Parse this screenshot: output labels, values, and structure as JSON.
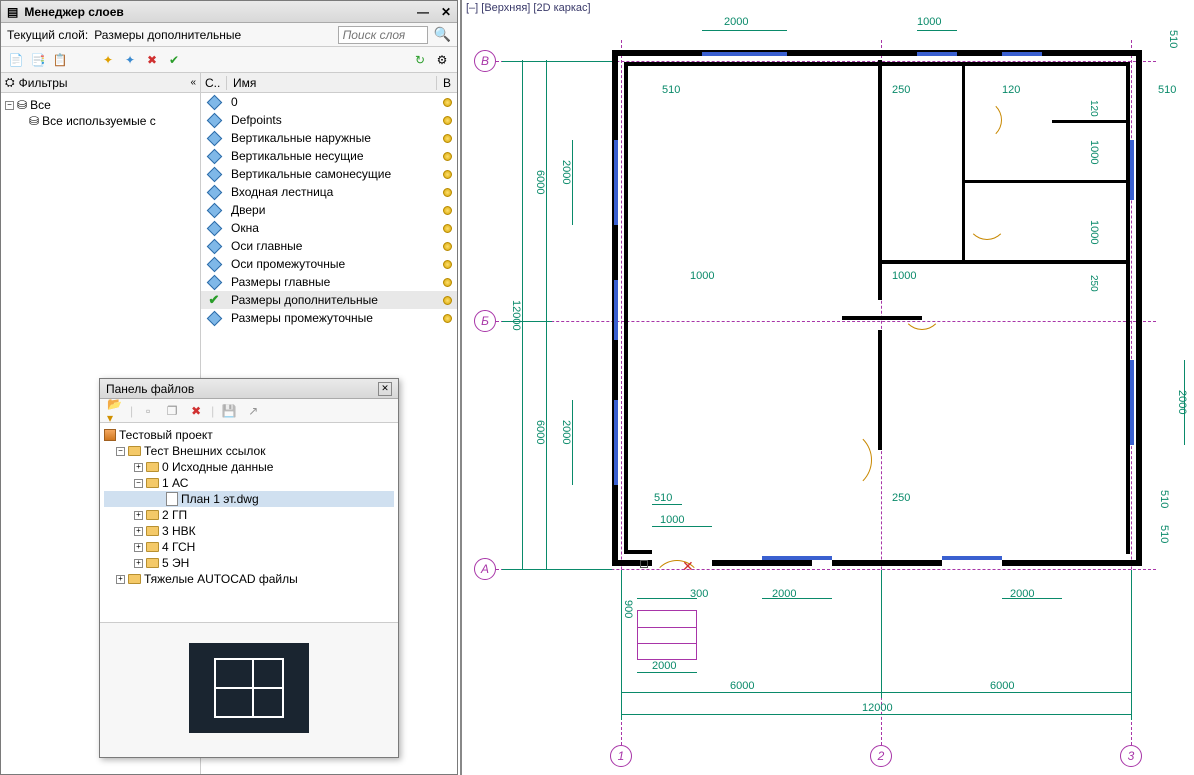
{
  "layer_manager": {
    "title": "Менеджер слоев",
    "current_prefix": "Текущий слой:",
    "current_layer": "Размеры дополнительные",
    "search_placeholder": "Поиск слоя",
    "filters_label": "Фильтры",
    "filter_all": "Все",
    "filter_used": "Все используемые с",
    "col_status": "С..",
    "col_name": "Имя",
    "col_on": "В",
    "layers": [
      {
        "name": "0",
        "current": false,
        "on": true
      },
      {
        "name": "Defpoints",
        "current": false,
        "on": true
      },
      {
        "name": "Вертикальные наружные",
        "current": false,
        "on": true
      },
      {
        "name": "Вертикальные несущие",
        "current": false,
        "on": true
      },
      {
        "name": "Вертикальные самонесущие",
        "current": false,
        "on": true
      },
      {
        "name": "Входная лестница",
        "current": false,
        "on": true
      },
      {
        "name": "Двери",
        "current": false,
        "on": true
      },
      {
        "name": "Окна",
        "current": false,
        "on": true
      },
      {
        "name": "Оси главные",
        "current": false,
        "on": true
      },
      {
        "name": "Оси промежуточные",
        "current": false,
        "on": true
      },
      {
        "name": "Размеры главные",
        "current": false,
        "on": true
      },
      {
        "name": "Размеры дополнительные",
        "current": true,
        "on": true
      },
      {
        "name": "Размеры промежуточные",
        "current": false,
        "on": true
      }
    ]
  },
  "file_panel": {
    "title": "Панель файлов",
    "project": "Тестовый проект",
    "nodes": [
      {
        "label": "Тест Внешних ссылок",
        "depth": 1,
        "expanded": true,
        "type": "folder"
      },
      {
        "label": "0 Исходные данные",
        "depth": 2,
        "expanded": false,
        "type": "folder"
      },
      {
        "label": "1 АС",
        "depth": 2,
        "expanded": true,
        "type": "folder"
      },
      {
        "label": "План 1 эт.dwg",
        "depth": 3,
        "expanded": null,
        "type": "dwg",
        "selected": true
      },
      {
        "label": "2 ГП",
        "depth": 2,
        "expanded": false,
        "type": "folder"
      },
      {
        "label": "3 НВК",
        "depth": 2,
        "expanded": false,
        "type": "folder"
      },
      {
        "label": "4 ГСН",
        "depth": 2,
        "expanded": false,
        "type": "folder"
      },
      {
        "label": "5 ЭН",
        "depth": 2,
        "expanded": false,
        "type": "folder"
      },
      {
        "label": "Тяжелые AUTOCAD файлы",
        "depth": 1,
        "expanded": false,
        "type": "folder"
      }
    ]
  },
  "viewport": {
    "title": "[–] [Верхняя] [2D каркас]",
    "axes": {
      "rows": [
        "В",
        "Б",
        "А"
      ],
      "cols": [
        "1",
        "2",
        "3"
      ]
    },
    "dims": {
      "top_outer": [
        "2000",
        "1000"
      ],
      "top_inner": [
        "510",
        "250",
        "120"
      ],
      "right_outer": [
        "510",
        "2000"
      ],
      "right_inner": [
        "1000",
        "120",
        "1000",
        "250",
        "510",
        "510"
      ],
      "left_outer": [
        "6000",
        "6000"
      ],
      "left_inner": [
        "2000",
        "2000",
        "12000"
      ],
      "bottom_rows": [
        [
          "300",
          "2000",
          "2000"
        ],
        [
          "2000"
        ],
        [
          "6000",
          "6000"
        ],
        [
          "12000"
        ]
      ],
      "misc": [
        "510",
        "1000",
        "1000",
        "250",
        "510",
        "900",
        "1000"
      ]
    }
  }
}
